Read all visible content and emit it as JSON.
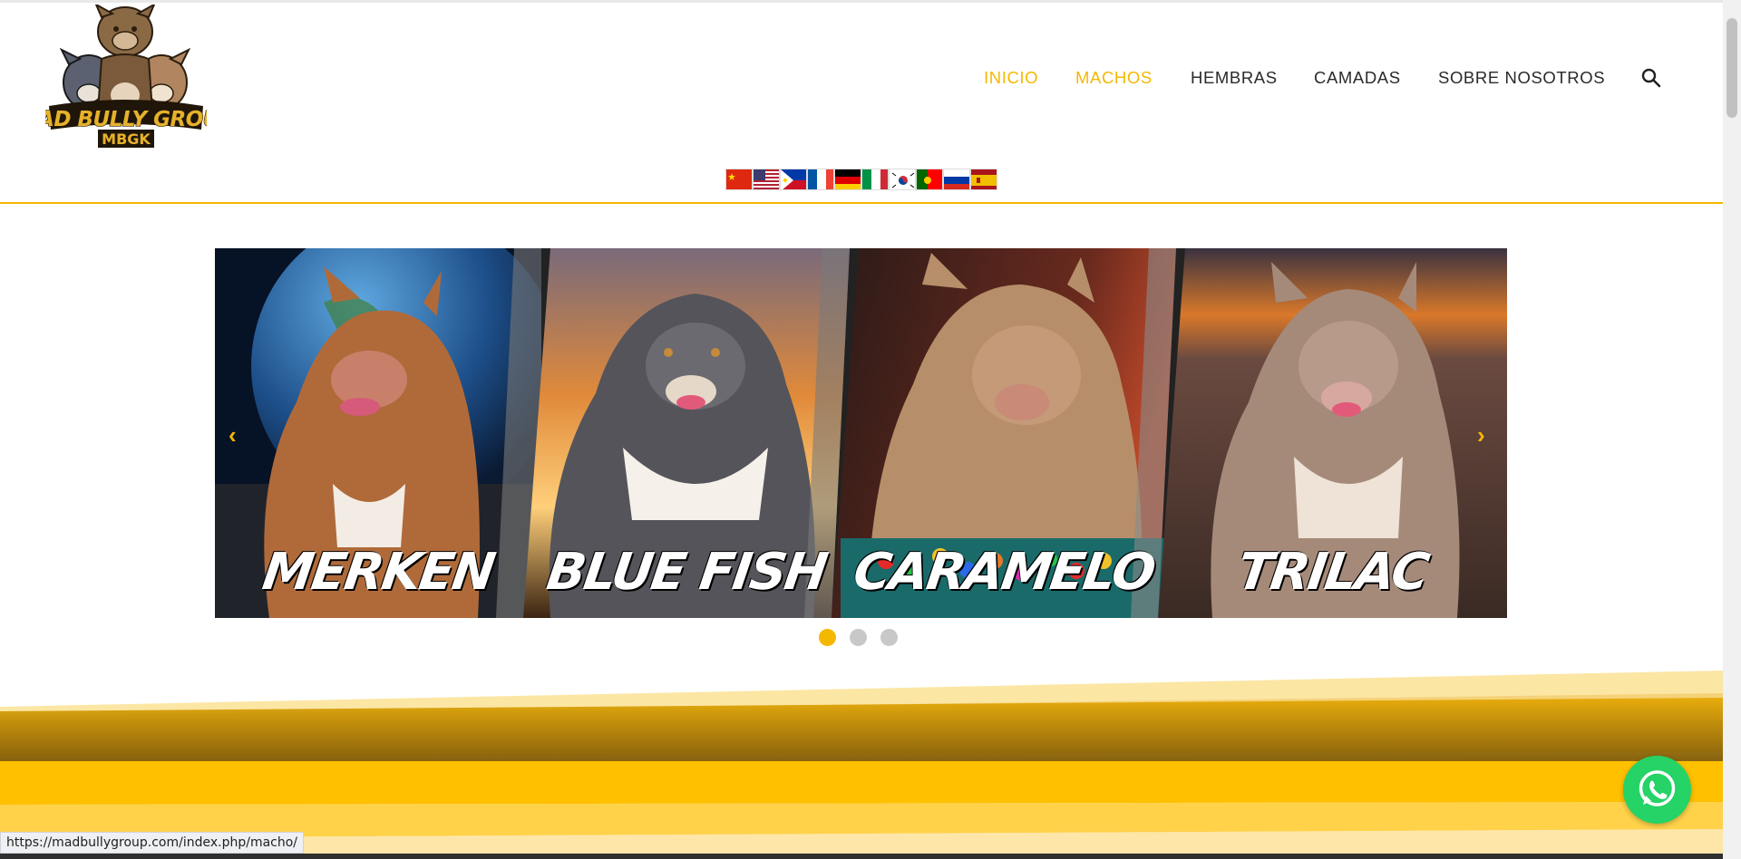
{
  "logo": {
    "brand_line": "MAD BULLY GROUP",
    "brand_abbr": "MBGK"
  },
  "nav": {
    "items": [
      {
        "label": "INICIO",
        "active": true
      },
      {
        "label": "MACHOS",
        "active": true
      },
      {
        "label": "HEMBRAS",
        "active": false
      },
      {
        "label": "CAMADAS",
        "active": false
      },
      {
        "label": "SOBRE NOSOTROS",
        "active": false
      }
    ],
    "search_icon": "search-icon"
  },
  "languages": [
    "zh",
    "en-us",
    "fil",
    "fr",
    "de",
    "it",
    "ko",
    "pt",
    "ru",
    "es"
  ],
  "slider": {
    "slides": [
      {
        "name": "MERKEN"
      },
      {
        "name": "BLUE FISH"
      },
      {
        "name": "CARAMELO"
      },
      {
        "name": "TRILAC"
      }
    ],
    "prev_icon": "chevron-left-icon",
    "next_icon": "chevron-right-icon",
    "dots": 3,
    "active_dot": 0
  },
  "status_url": "https://madbullygroup.com/index.php/macho/",
  "colors": {
    "accent": "#f5b800",
    "whatsapp": "#25d366"
  }
}
